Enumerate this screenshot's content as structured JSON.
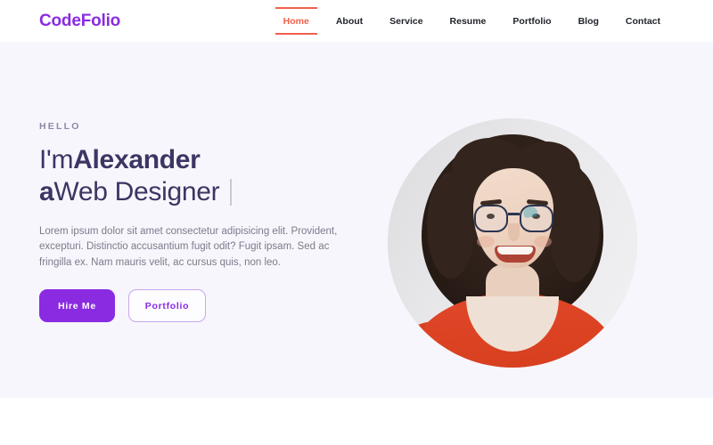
{
  "header": {
    "brand": "CodeFolio",
    "nav": [
      {
        "label": "Home",
        "active": true
      },
      {
        "label": "About",
        "active": false
      },
      {
        "label": "Service",
        "active": false
      },
      {
        "label": "Resume",
        "active": false
      },
      {
        "label": "Portfolio",
        "active": false
      },
      {
        "label": "Blog",
        "active": false
      },
      {
        "label": "Contact",
        "active": false
      }
    ]
  },
  "hero": {
    "eyebrow": "HELLO",
    "headline_line1_prefix": "I'm ",
    "headline_line1_strong": "Alexander",
    "headline_line2_strong": "a",
    "headline_line2_suffix": " Web Designer",
    "paragraph": "Lorem ipsum dolor sit amet consectetur adipisicing elit. Provident, excepturi. Distinctio accusantium fugit odit? Fugit ipsam. Sed ac fringilla ex. Nam mauris velit, ac cursus quis, non leo.",
    "primary_button": "Hire Me",
    "outline_button": "Portfolio",
    "portrait_alt": "portrait-photo-smiling-woman-curly-hair-glasses-orange-top"
  },
  "colors": {
    "brand_purple": "#8a2be2",
    "accent_coral": "#f1604d",
    "heading_navy": "#3b3663",
    "hero_background": "#f7f6fd",
    "body_text": "#7b7b8b",
    "eyebrow_text": "#8b89a8",
    "outline_border": "#c9a6ee",
    "nav_text": "#21242b"
  }
}
